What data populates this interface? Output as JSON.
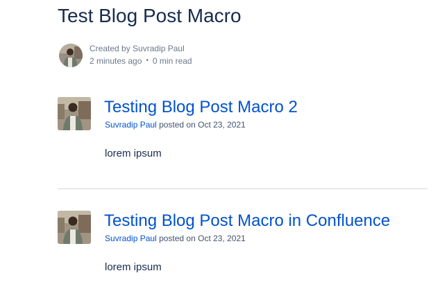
{
  "page": {
    "title": "Test Blog Post Macro"
  },
  "byline": {
    "created_prefix": "Created by",
    "author": "Suvradip Paul",
    "time_ago": "2 minutes ago",
    "separator": "•",
    "read_time": "0 min read",
    "avatar_icon": "user-avatar-icon"
  },
  "posts": [
    {
      "title": "Testing Blog Post Macro 2",
      "author": "Suvradip Paul",
      "posted_on": "posted on Oct 23, 2021",
      "excerpt": "lorem ipsum",
      "avatar_icon": "user-avatar-icon"
    },
    {
      "title": "Testing Blog Post Macro in Confluence",
      "author": "Suvradip Paul",
      "posted_on": "posted on Oct 23, 2021",
      "excerpt": "lorem ipsum",
      "avatar_icon": "user-avatar-icon"
    }
  ],
  "colors": {
    "link": "#0052cc",
    "text": "#172b4d",
    "subtle": "#6b778c",
    "divider": "#d5d8de"
  }
}
